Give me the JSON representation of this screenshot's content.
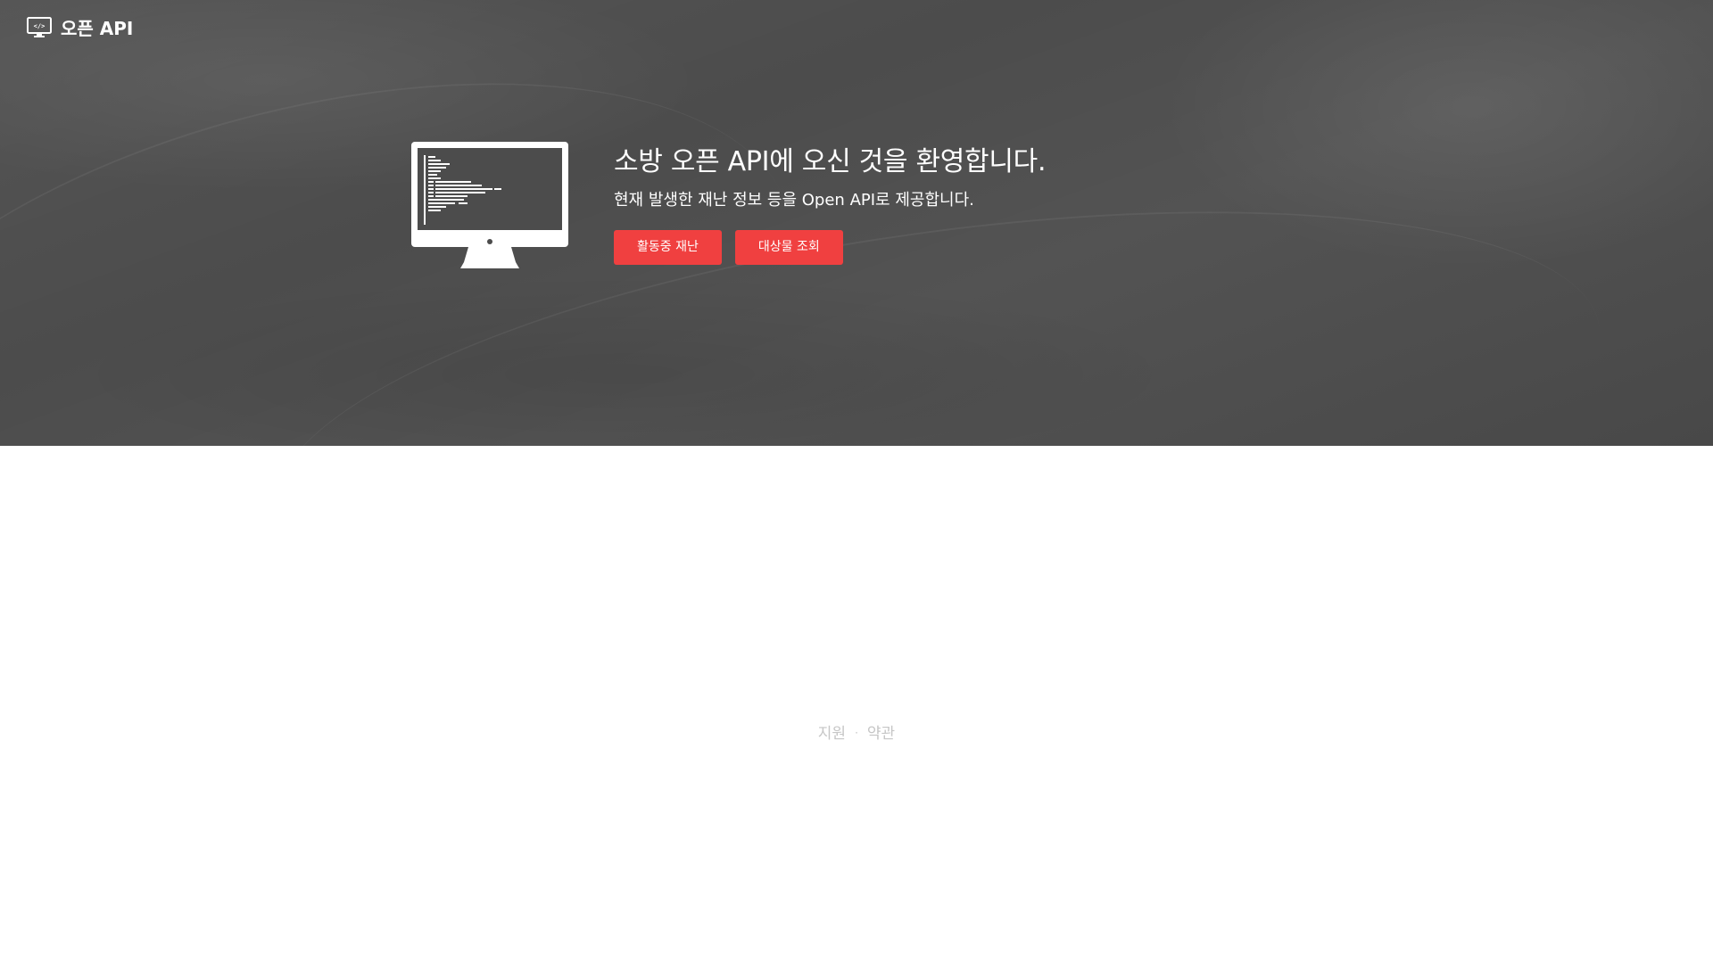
{
  "header": {
    "brand_label": "오픈 API",
    "brand_icon": "monitor-code-icon"
  },
  "hero": {
    "title": "소방 오픈 API에 오신 것을 환영합니다.",
    "subtitle": "현재 발생한 재난 정보 등을 Open API로 제공합니다.",
    "illustration_icon": "monitor-code-icon",
    "buttons": {
      "active_disaster": "활동중 재난",
      "target_lookup": "대상물 조회"
    }
  },
  "footer": {
    "support_label": "지원",
    "separator": "·",
    "terms_label": "약관"
  },
  "colors": {
    "hero_background": "#4c4c4c",
    "accent_button": "#f04040",
    "footer_text": "#c6c6c6"
  }
}
